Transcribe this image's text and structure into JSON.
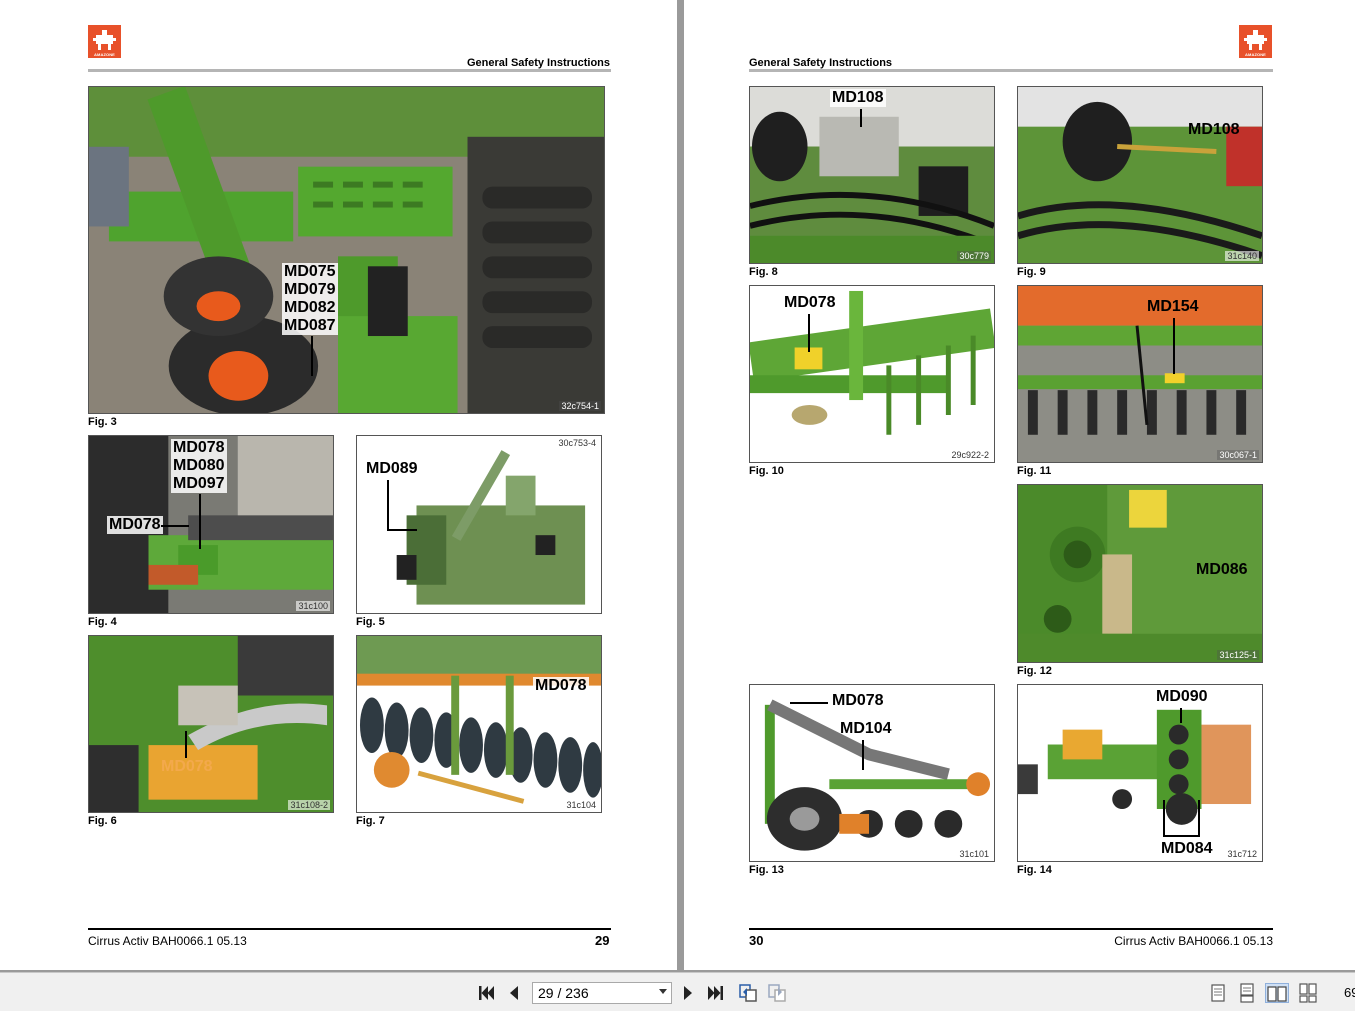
{
  "left_page": {
    "header_title": "General Safety Instructions",
    "logo_text": "AMAZONE",
    "figures": [
      {
        "caption": "Fig. 3",
        "code": "32c754-1",
        "labels": [
          "MD075",
          "MD079",
          "MD082",
          "MD087"
        ]
      },
      {
        "caption": "Fig. 4",
        "code": "31c100",
        "labels": [
          "MD078",
          "MD080",
          "MD097",
          "MD078"
        ]
      },
      {
        "caption": "Fig. 5",
        "code": "30c753-4",
        "labels": [
          "MD089"
        ]
      },
      {
        "caption": "Fig. 6",
        "code": "31c108-2",
        "labels": [
          "MD078"
        ]
      },
      {
        "caption": "Fig. 7",
        "code": "31c104",
        "labels": [
          "MD078"
        ]
      }
    ],
    "footer_text": "Cirrus Activ  BAH0066.1  05.13",
    "page_number": "29"
  },
  "right_page": {
    "header_title": "General Safety Instructions",
    "logo_text": "AMAZONE",
    "figures": [
      {
        "caption": "Fig. 8",
        "code": "30c779",
        "labels": [
          "MD108"
        ]
      },
      {
        "caption": "Fig. 9",
        "code": "31c140",
        "labels": [
          "MD108"
        ]
      },
      {
        "caption": "Fig. 10",
        "code": "29c922-2",
        "labels": [
          "MD078"
        ]
      },
      {
        "caption": "Fig. 11",
        "code": "30c067-1",
        "labels": [
          "MD154"
        ]
      },
      {
        "caption": "Fig. 12",
        "code": "31c125-1",
        "labels": [
          "MD086"
        ]
      },
      {
        "caption": "Fig. 13",
        "code": "31c101",
        "labels": [
          "MD078",
          "MD104"
        ]
      },
      {
        "caption": "Fig. 14",
        "code": "31c712",
        "labels": [
          "MD090",
          "MD084"
        ]
      }
    ],
    "footer_text": "Cirrus Activ  BAH0066.1  05.13",
    "page_number": "30"
  },
  "toolbar": {
    "page_indicator": "29 / 236",
    "zoom": "69",
    "icons": [
      "first-page-icon",
      "previous-page-icon",
      "next-page-icon",
      "last-page-icon",
      "previous-view-icon",
      "next-view-icon",
      "single-page-icon",
      "continuous-page-icon",
      "facing-pages-icon",
      "continuous-facing-icon"
    ]
  },
  "colors": {
    "machine_green": "#4f9a2c",
    "brand_orange": "#e8512a",
    "toolbar_bg": "#f0f0f0",
    "gutter_gray": "#9a9a9a"
  }
}
